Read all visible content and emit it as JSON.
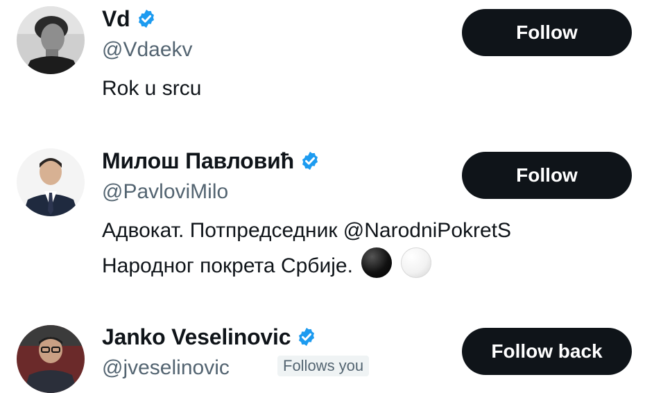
{
  "users": [
    {
      "name": "Vd",
      "handle": "@Vdaekv",
      "bio": "Rok u srcu",
      "button_label": "Follow",
      "verified": true,
      "avatar_icon": "avatar-photo-bw"
    },
    {
      "name": "Милош Павловић",
      "handle": "@PavloviMilo",
      "bio_line1": "Адвокат. Потпредседник @NarodniPokretS",
      "bio_line2": "Народног покрета Србије.",
      "bio_emojis": [
        "black-circle-emoji",
        "white-circle-emoji"
      ],
      "button_label": "Follow",
      "verified": true,
      "avatar_icon": "avatar-photo-suit"
    },
    {
      "name": "Janko Veselinovic",
      "handle": "@jveselinovic",
      "follows_you": "Follows you",
      "button_label": "Follow back",
      "verified": true,
      "avatar_icon": "avatar-photo-glasses"
    }
  ],
  "colors": {
    "verified_blue": "#1d9bf0",
    "button_bg": "#0f1419",
    "handle_gray": "#536471"
  }
}
